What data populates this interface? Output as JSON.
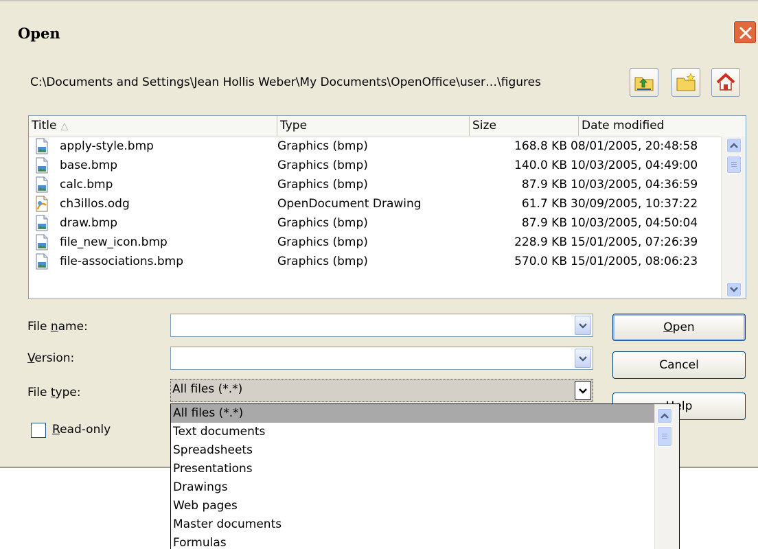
{
  "dialog": {
    "title": "Open",
    "path": "C:\\Documents and Settings\\Jean Hollis Weber\\My Documents\\OpenOffice\\user…\\figures"
  },
  "toolbar": {
    "up_icon": "folder-up-icon",
    "new_folder_icon": "new-folder-icon",
    "home_icon": "home-icon"
  },
  "file_list": {
    "columns": [
      "Title",
      "Type",
      "Size",
      "Date modified"
    ],
    "rows": [
      {
        "name": "apply-style.bmp",
        "type": "Graphics (bmp)",
        "size": "168.8 KB",
        "date": "08/01/2005, 20:48:58",
        "icon": "bitmap-file-icon"
      },
      {
        "name": "base.bmp",
        "type": "Graphics (bmp)",
        "size": "140.0 KB",
        "date": "10/03/2005, 04:49:00",
        "icon": "bitmap-file-icon"
      },
      {
        "name": "calc.bmp",
        "type": "Graphics (bmp)",
        "size": "87.9 KB",
        "date": "10/03/2005, 04:36:59",
        "icon": "bitmap-file-icon"
      },
      {
        "name": "ch3illos.odg",
        "type": "OpenDocument Drawing",
        "size": "61.7 KB",
        "date": "30/09/2005, 10:37:22",
        "icon": "drawing-file-icon"
      },
      {
        "name": "draw.bmp",
        "type": "Graphics (bmp)",
        "size": "87.9 KB",
        "date": "10/03/2005, 04:50:04",
        "icon": "bitmap-file-icon"
      },
      {
        "name": "file_new_icon.bmp",
        "type": "Graphics (bmp)",
        "size": "228.9 KB",
        "date": "15/01/2005, 07:26:39",
        "icon": "bitmap-file-icon"
      },
      {
        "name": "file-associations.bmp",
        "type": "Graphics (bmp)",
        "size": "570.0 KB",
        "date": "15/01/2005, 08:06:23",
        "icon": "bitmap-file-icon"
      }
    ]
  },
  "form": {
    "file_name_label": "File name:",
    "file_name_value": "",
    "version_label": "Version:",
    "version_value": "",
    "file_type_label": "File type:",
    "file_type_value": "All files (*.*)",
    "readonly_label": "Read-only",
    "readonly_checked": false
  },
  "buttons": {
    "open": "Open",
    "cancel": "Cancel",
    "help": "Help"
  },
  "file_type_options": [
    "All files (*.*)",
    "Text documents",
    "Spreadsheets",
    "Presentations",
    "Drawings",
    "Web pages",
    "Master documents",
    "Formulas"
  ],
  "colors": {
    "dialog_bg": "#ece9d8",
    "selection": "#a9a9a9",
    "close_button": "#e2693e"
  }
}
